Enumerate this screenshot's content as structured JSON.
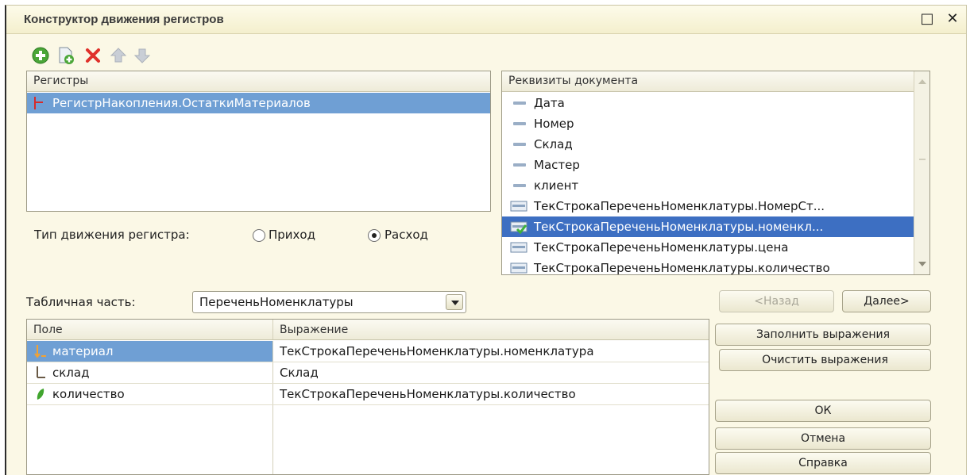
{
  "window": {
    "title": "Конструктор движения регистров",
    "maximize_glyph": "□",
    "close_glyph": "✕"
  },
  "toolbar": {
    "buttons": [
      {
        "name": "add-icon"
      },
      {
        "name": "add-from-icon"
      },
      {
        "name": "delete-icon"
      },
      {
        "name": "move-up-icon"
      },
      {
        "name": "move-down-icon"
      }
    ]
  },
  "registers": {
    "header": "Регистры",
    "items": [
      "РегистрНакопления.ОстаткиМатериалов"
    ]
  },
  "movement_type": {
    "label": "Тип движения регистра:",
    "options": [
      "Приход",
      "Расход"
    ],
    "selected": "Расход"
  },
  "doc_attributes": {
    "header": "Реквизиты документа",
    "items": [
      "Дата",
      "Номер",
      "Склад",
      "Мастер",
      "клиент",
      "ТекСтрокаПереченьНоменклатуры.НомерСт...",
      "ТекСтрокаПереченьНоменклатуры.номенкл...",
      "ТекСтрокаПереченьНоменклатуры.цена",
      "ТекСтрокаПереченьНоменклатуры.количество"
    ],
    "selected_index": 6
  },
  "table_part": {
    "label": "Табличная часть:",
    "value": "ПереченьНоменклатуры"
  },
  "fields_grid": {
    "columns": [
      "Поле",
      "Выражение"
    ],
    "rows": [
      {
        "field": "материал",
        "expression": "ТекСтрокаПереченьНоменклатуры.номенклатура"
      },
      {
        "field": "склад",
        "expression": "Склад"
      },
      {
        "field": "количество",
        "expression": "ТекСтрокаПереченьНоменклатуры.количество"
      }
    ],
    "selected_index": 0
  },
  "buttons": {
    "back": "<Назад",
    "next": "Далее>",
    "fill": "Заполнить выражения",
    "clear": "Очистить выражения",
    "ok": "ОК",
    "cancel": "Отмена",
    "help": "Справка"
  },
  "colors": {
    "selection": "#6f9fd4",
    "selection_focused": "#3d6fc2",
    "background": "#fbf8e6"
  }
}
